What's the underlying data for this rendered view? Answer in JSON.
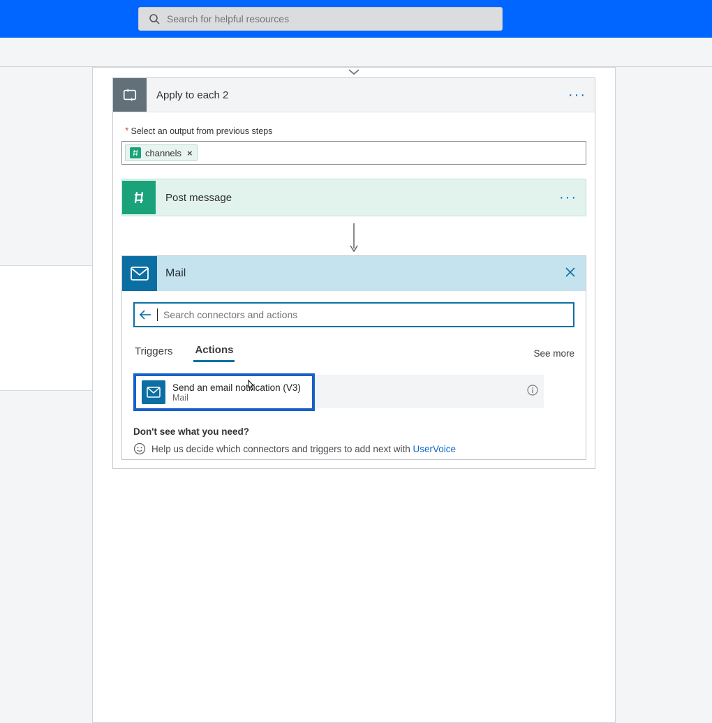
{
  "topbar": {
    "search_placeholder": "Search for helpful resources"
  },
  "apply_each": {
    "title": "Apply to each 2",
    "field_label": "Select an output from previous steps",
    "token": {
      "label": "channels"
    },
    "menu_glyph": "···"
  },
  "post_message": {
    "title": "Post message",
    "menu_glyph": "···"
  },
  "mail_picker": {
    "title": "Mail",
    "search_placeholder": "Search connectors and actions",
    "tab_triggers": "Triggers",
    "tab_actions": "Actions",
    "see_more": "See more",
    "action": {
      "title": "Send an email notification (V3)",
      "subtitle": "Mail"
    },
    "help": {
      "question": "Don't see what you need?",
      "line_prefix": "Help us decide which connectors and triggers to add next with ",
      "link": "UserVoice"
    }
  },
  "colors": {
    "brand_blue": "#0066ff",
    "mail_blue": "#0b6fa4",
    "slack_green": "#1aa37a",
    "apply_grey": "#62707a",
    "highlight_blue": "#1860c9",
    "link_blue": "#1068c9"
  }
}
